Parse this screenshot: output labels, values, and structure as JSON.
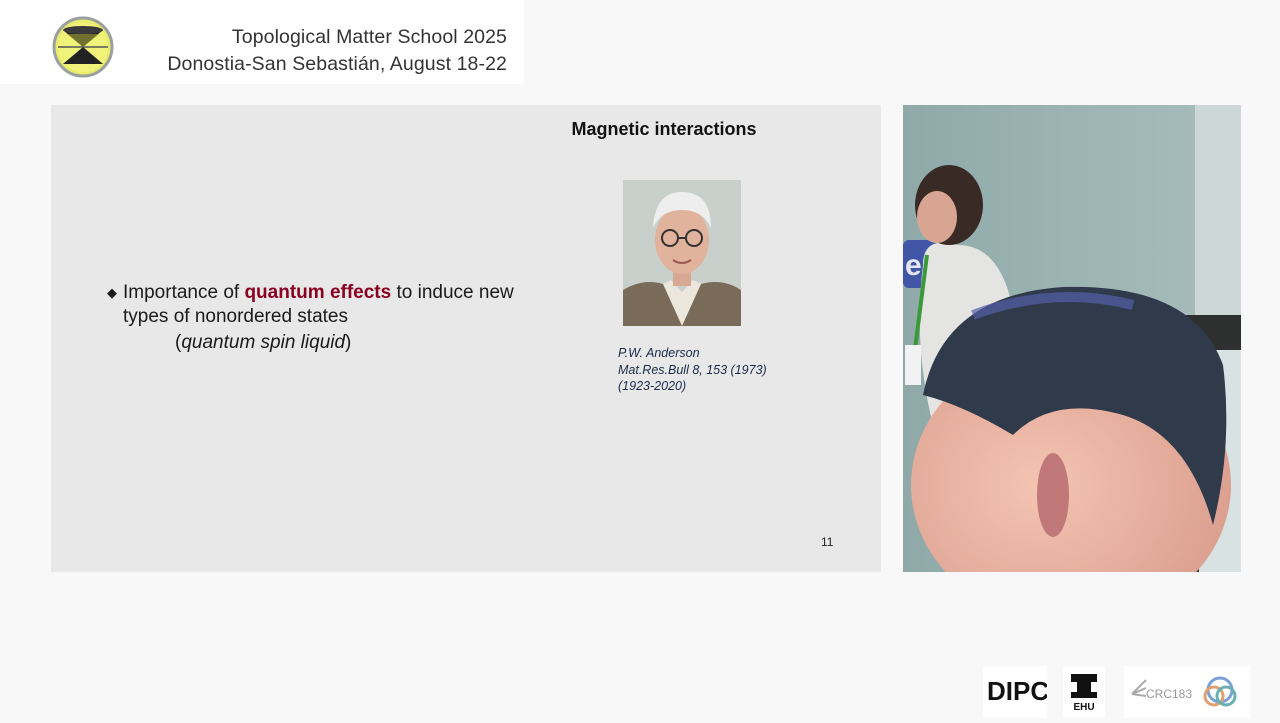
{
  "header": {
    "title_line1": "Topological Matter School 2025",
    "title_line2": "Donostia-San Sebastián, August 18-22"
  },
  "slide": {
    "heading": "Magnetic interactions",
    "bullet": {
      "marker": "◆",
      "pre": "Importance of ",
      "emph": "quantum effects",
      "post": " to induce new",
      "line2": "types of nonordered states",
      "line3_open": "(",
      "line3_italic": "quantum spin liquid",
      "line3_close": ")"
    },
    "caption": {
      "line1": "P.W. Anderson",
      "line2": "Mat.Res.Bull 8, 153 (1973)",
      "line3": "(1923-2020)"
    },
    "page_number": "11",
    "emphasis_color": "#8b0020"
  },
  "logos": {
    "dipc": "DIPC",
    "ehu": "EHU",
    "crc": "CRC183"
  }
}
